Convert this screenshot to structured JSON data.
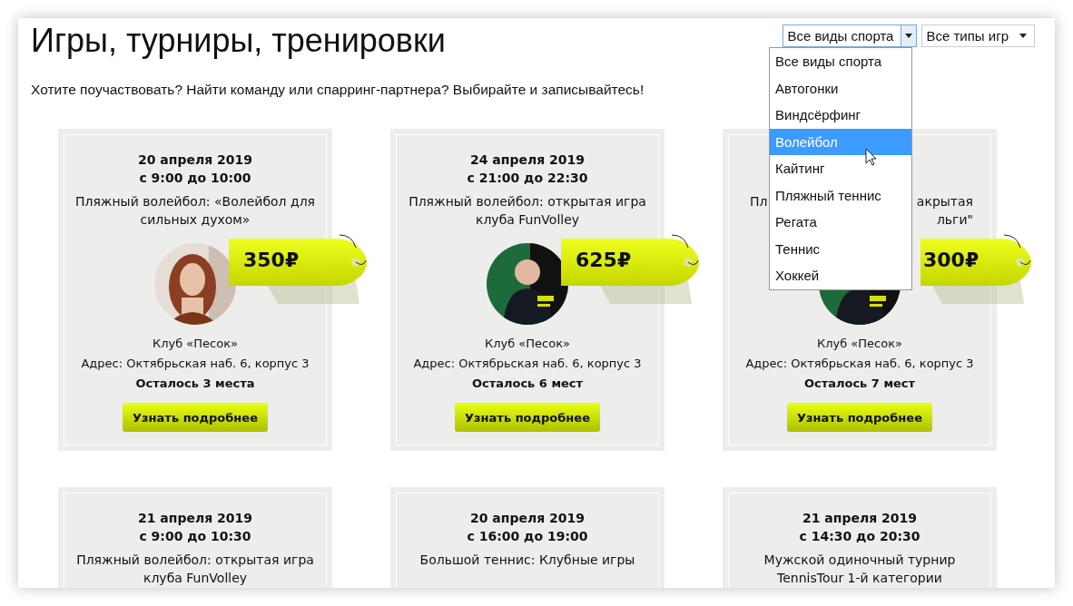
{
  "title": "Игры, турниры, тренировки",
  "subtitle": "Хотите поучаствовать? Найти команду или спарринг-партнера? Выбирайте и записывайтесь!",
  "filters": [
    {
      "value": "Все виды спорта",
      "expanded": true
    },
    {
      "value": "Все типы игр",
      "expanded": false
    }
  ],
  "sport_options": [
    {
      "label": "Все виды спорта",
      "selected": false
    },
    {
      "label": "Автогонки",
      "selected": false
    },
    {
      "label": "Виндсёрфинг",
      "selected": false
    },
    {
      "label": "Волейбол",
      "selected": true
    },
    {
      "label": "Кайтинг",
      "selected": false
    },
    {
      "label": "Пляжный теннис",
      "selected": false
    },
    {
      "label": "Регата",
      "selected": false
    },
    {
      "label": "Теннис",
      "selected": false
    },
    {
      "label": "Хоккей",
      "selected": false
    }
  ],
  "cards": [
    {
      "date": "20 апреля 2019",
      "time": "с 9:00 до 10:00",
      "title": "Пляжный волейбол: «Волейбол для сильных духом»",
      "price": "350₽",
      "photo": {
        "kind": "picture"
      },
      "club": "Клуб «Песок»",
      "address": "Адрес: Октябрьская наб. 6, корпус 3",
      "places": "Осталось 3 места",
      "button": "Узнать подробнее"
    },
    {
      "date": "24 апреля 2019",
      "time": "с 21:00 до 22:30",
      "title": "Пляжный волейбол: открытая игра клуба FunVolley",
      "price": "625₽",
      "photo": {
        "kind": "picture"
      },
      "club": "Клуб «Песок»",
      "address": "Адрес: Октябрьская наб. 6, корпус 3",
      "places": "Осталось 6 мест",
      "button": "Узнать подробнее"
    },
    {
      "title_fragments": [
        [
          "Пл",
          "акрытая"
        ],
        [
          "льги\""
        ]
      ],
      "price": "300₽",
      "photo": {
        "kind": "picture"
      },
      "club": "Клуб «Песок»",
      "address": "Адрес: Октябрьская наб. 6, корпус 3",
      "places": "Осталось 7 мест",
      "button": "Узнать подробнее"
    },
    {
      "date": "21 апреля 2019",
      "time": "с 9:00 до 10:30",
      "title": "Пляжный волейбол: открытая игра клуба FunVolley"
    },
    {
      "date": "20 апреля 2019",
      "time": "с 16:00 до 19:00",
      "title": "Большой теннис: Клубные игры"
    },
    {
      "date": "21 апреля 2019",
      "time": "с 14:30 до 20:30",
      "title": "Мужской одиночный турнир TennisTour 1-й категории"
    }
  ]
}
